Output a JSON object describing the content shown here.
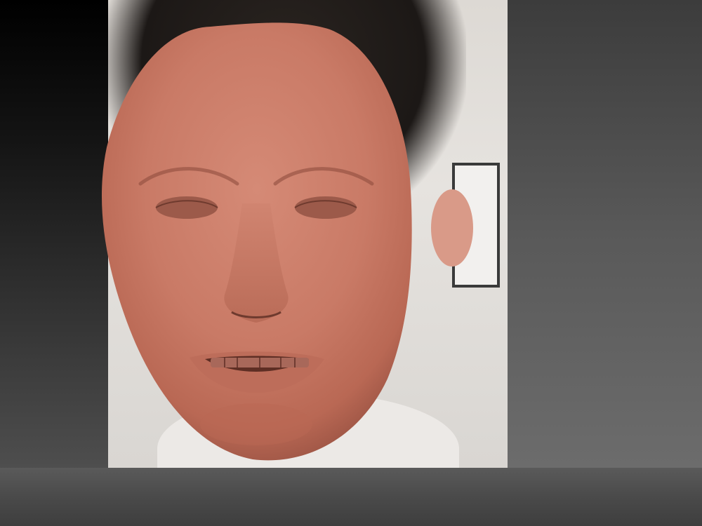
{
  "app": {
    "viewport_background": "#2b2b2b"
  },
  "reference_image": {
    "kind": "front-view photo reference",
    "background_tone": "#e2dfdb"
  },
  "sculpt": {
    "material_color": "#c97a66",
    "shadow_color": "#7a4538",
    "subject": "face-mask mesh"
  },
  "color_swatch": {
    "color": "#c73a34"
  }
}
